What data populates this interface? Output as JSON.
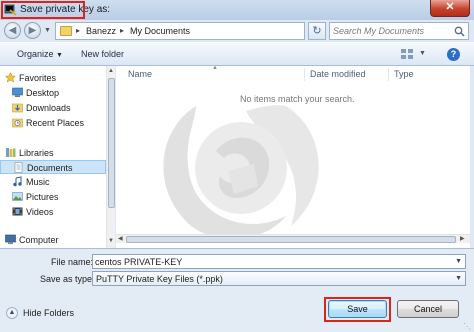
{
  "window": {
    "title": "Save private key as:",
    "close_glyph": "✕"
  },
  "address": {
    "segments": [
      "Banezz",
      "My Documents"
    ],
    "search_placeholder": "Search My Documents"
  },
  "toolbar": {
    "organize_label": "Organize",
    "new_folder_label": "New folder"
  },
  "nav": {
    "items": [
      {
        "label": "Favorites",
        "icon": "star-icon",
        "group": true
      },
      {
        "label": "Desktop",
        "icon": "desktop-icon"
      },
      {
        "label": "Downloads",
        "icon": "downloads-icon"
      },
      {
        "label": "Recent Places",
        "icon": "recent-places-icon"
      },
      {
        "label": "Libraries",
        "icon": "libraries-icon",
        "group": true
      },
      {
        "label": "Documents",
        "icon": "documents-icon",
        "selected": true
      },
      {
        "label": "Music",
        "icon": "music-icon"
      },
      {
        "label": "Pictures",
        "icon": "pictures-icon"
      },
      {
        "label": "Videos",
        "icon": "videos-icon"
      },
      {
        "label": "Computer",
        "icon": "computer-icon",
        "group": true
      }
    ]
  },
  "files": {
    "columns": [
      "Name",
      "Date modified",
      "Type"
    ],
    "empty_message": "No items match your search."
  },
  "form": {
    "file_name_label": "File name:",
    "file_name_value": "centos PRIVATE-KEY",
    "save_type_label": "Save as type:",
    "save_type_value": "PuTTY Private Key Files (*.ppk)"
  },
  "footer": {
    "hide_folders_label": "Hide Folders",
    "save_label": "Save",
    "cancel_label": "Cancel"
  },
  "colors": {
    "highlight": "#d9251d",
    "selection": "#cce4f7",
    "accent": "#3c7fb1"
  }
}
